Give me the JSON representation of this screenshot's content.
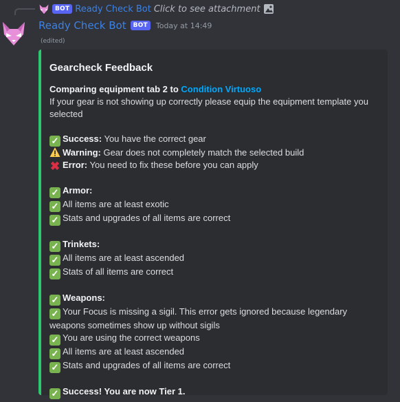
{
  "reply": {
    "bot_tag": "BOT",
    "name": "Ready Check Bot",
    "text": "Click to see attachment",
    "attachment_icon": "image-icon"
  },
  "message": {
    "username": "Ready Check Bot",
    "bot_tag": "BOT",
    "timestamp": "Today at 14:49",
    "edited": "(edited)"
  },
  "embed": {
    "accent_color": "#2dc770",
    "title": "Gearcheck Feedback",
    "comparing_prefix": "Comparing equipment tab 2 to",
    "comparing_link": "Condition Virtuoso",
    "instruction": "If your gear is not showing up correctly please equip the equipment template you selected",
    "legend": {
      "success_label": "Success:",
      "success_text": " You have the correct gear",
      "warning_label": "Warning:",
      "warning_text": " Gear does not completely match the selected build",
      "error_label": "Error:",
      "error_text": " You need to fix these before you can apply"
    },
    "sections": {
      "armor": {
        "heading": "Armor:",
        "items": [
          "All items are at least exotic",
          "Stats and upgrades of all items are correct"
        ]
      },
      "trinkets": {
        "heading": "Trinkets:",
        "items": [
          "All items are at least ascended",
          "Stats of all items are correct"
        ]
      },
      "weapons": {
        "heading": "Weapons:",
        "items": [
          "Your Focus is missing a sigil. This error gets ignored because legendary weapons sometimes show up without sigils",
          "You are using the correct weapons",
          "All items are at least ascended",
          "Stats and upgrades of all items are correct"
        ]
      }
    },
    "final": "Success! You are now Tier 1."
  }
}
